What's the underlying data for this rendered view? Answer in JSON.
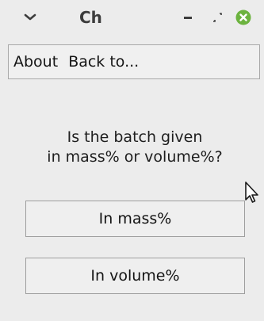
{
  "window": {
    "title": "Ch",
    "menu_icon": "chevron-down-icon",
    "minimize_icon": "minimize-icon",
    "maximize_icon": "restore-icon",
    "close_icon": "close-icon",
    "close_color": "#6cb33f"
  },
  "menubar": {
    "items": [
      {
        "label": "About"
      },
      {
        "label": "Back to..."
      }
    ]
  },
  "dialog": {
    "question_line1": "Is the batch given",
    "question_line2": "in mass% or volume%?"
  },
  "buttons": {
    "mass_label": "In mass%",
    "volume_label": "In volume%"
  },
  "cursor": {
    "icon": "mouse-pointer-icon"
  }
}
